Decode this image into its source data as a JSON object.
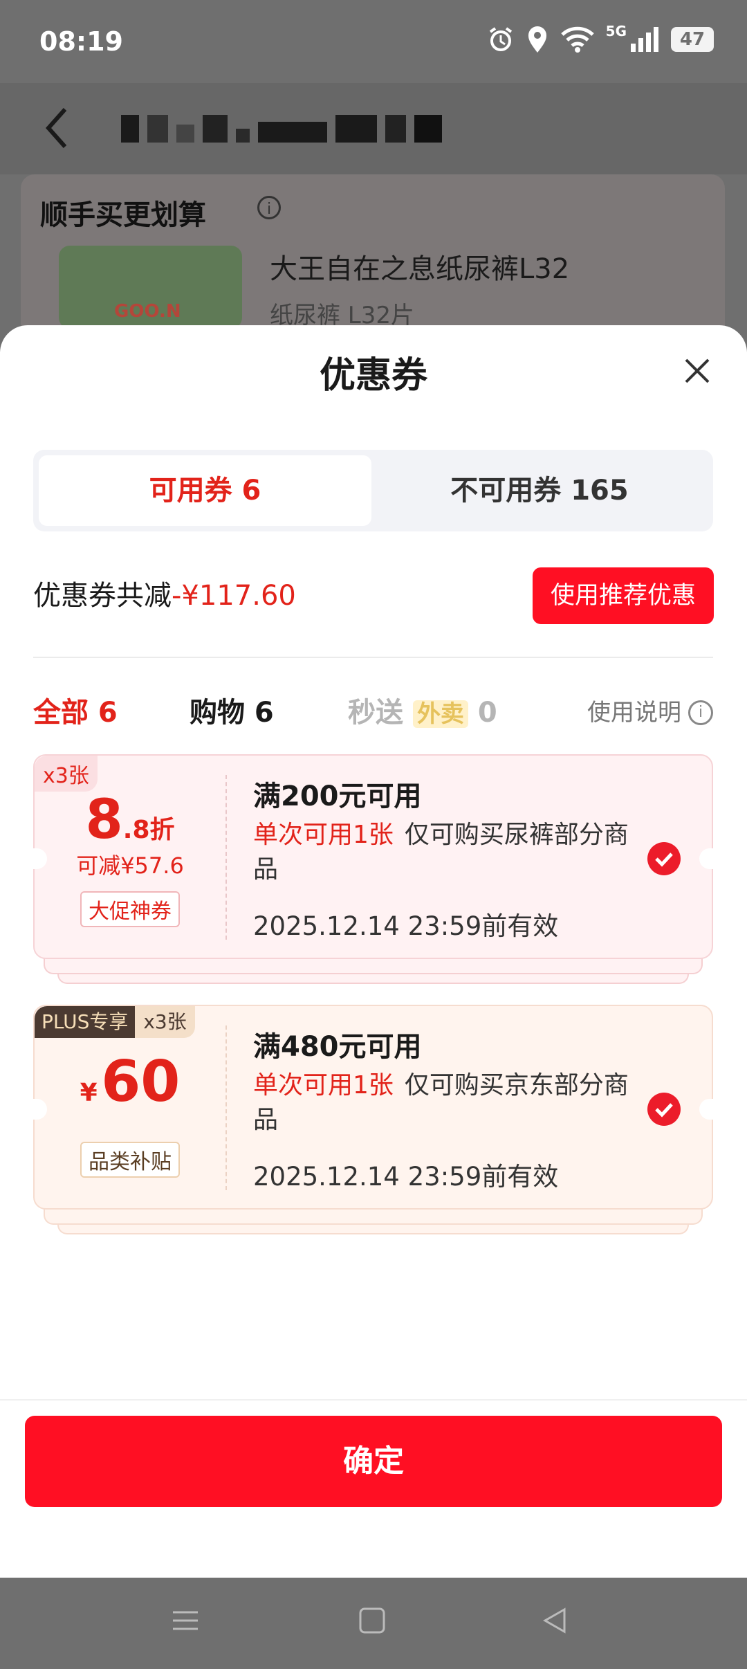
{
  "status_bar": {
    "time": "08:19",
    "network": "5G",
    "battery": "47"
  },
  "background": {
    "section_title": "顺手买更划算",
    "product": {
      "name": "大王自在之息纸尿裤L32",
      "spec": "纸尿裤 L32片",
      "brand": "GOO.N"
    }
  },
  "sheet": {
    "title": "优惠券",
    "tabs": [
      {
        "label": "可用券 6",
        "active": true
      },
      {
        "label": "不可用券 165",
        "active": false
      }
    ],
    "summary": {
      "label": "优惠券共减",
      "amount": "-¥117.60",
      "button": "使用推荐优惠"
    },
    "filters": {
      "all": "全部 6",
      "shopping": "购物 6",
      "second_prefix": "秒送",
      "second_tag": "外卖",
      "second_count": "0",
      "help": "使用说明"
    },
    "coupons": [
      {
        "count_tag": "x3张",
        "discount_main": "8",
        "discount_suffix": ".8折",
        "save": "可减¥57.6",
        "badge": "大促神券",
        "title": "满200元可用",
        "limit": "单次可用1张",
        "scope": "仅可购买尿裤部分商品",
        "expiry": "2025.12.14 23:59前有效",
        "selected": true
      },
      {
        "plus_tag": "PLUS专享",
        "count_tag": "x3张",
        "currency": "¥",
        "amount": "60",
        "badge": "品类补贴",
        "title": "满480元可用",
        "limit": "单次可用1张",
        "scope": "仅可购买京东部分商品",
        "expiry": "2025.12.14 23:59前有效",
        "selected": true
      }
    ],
    "confirm": "确定"
  },
  "colors": {
    "accent": "#e2231a",
    "button": "#ff0f23"
  }
}
